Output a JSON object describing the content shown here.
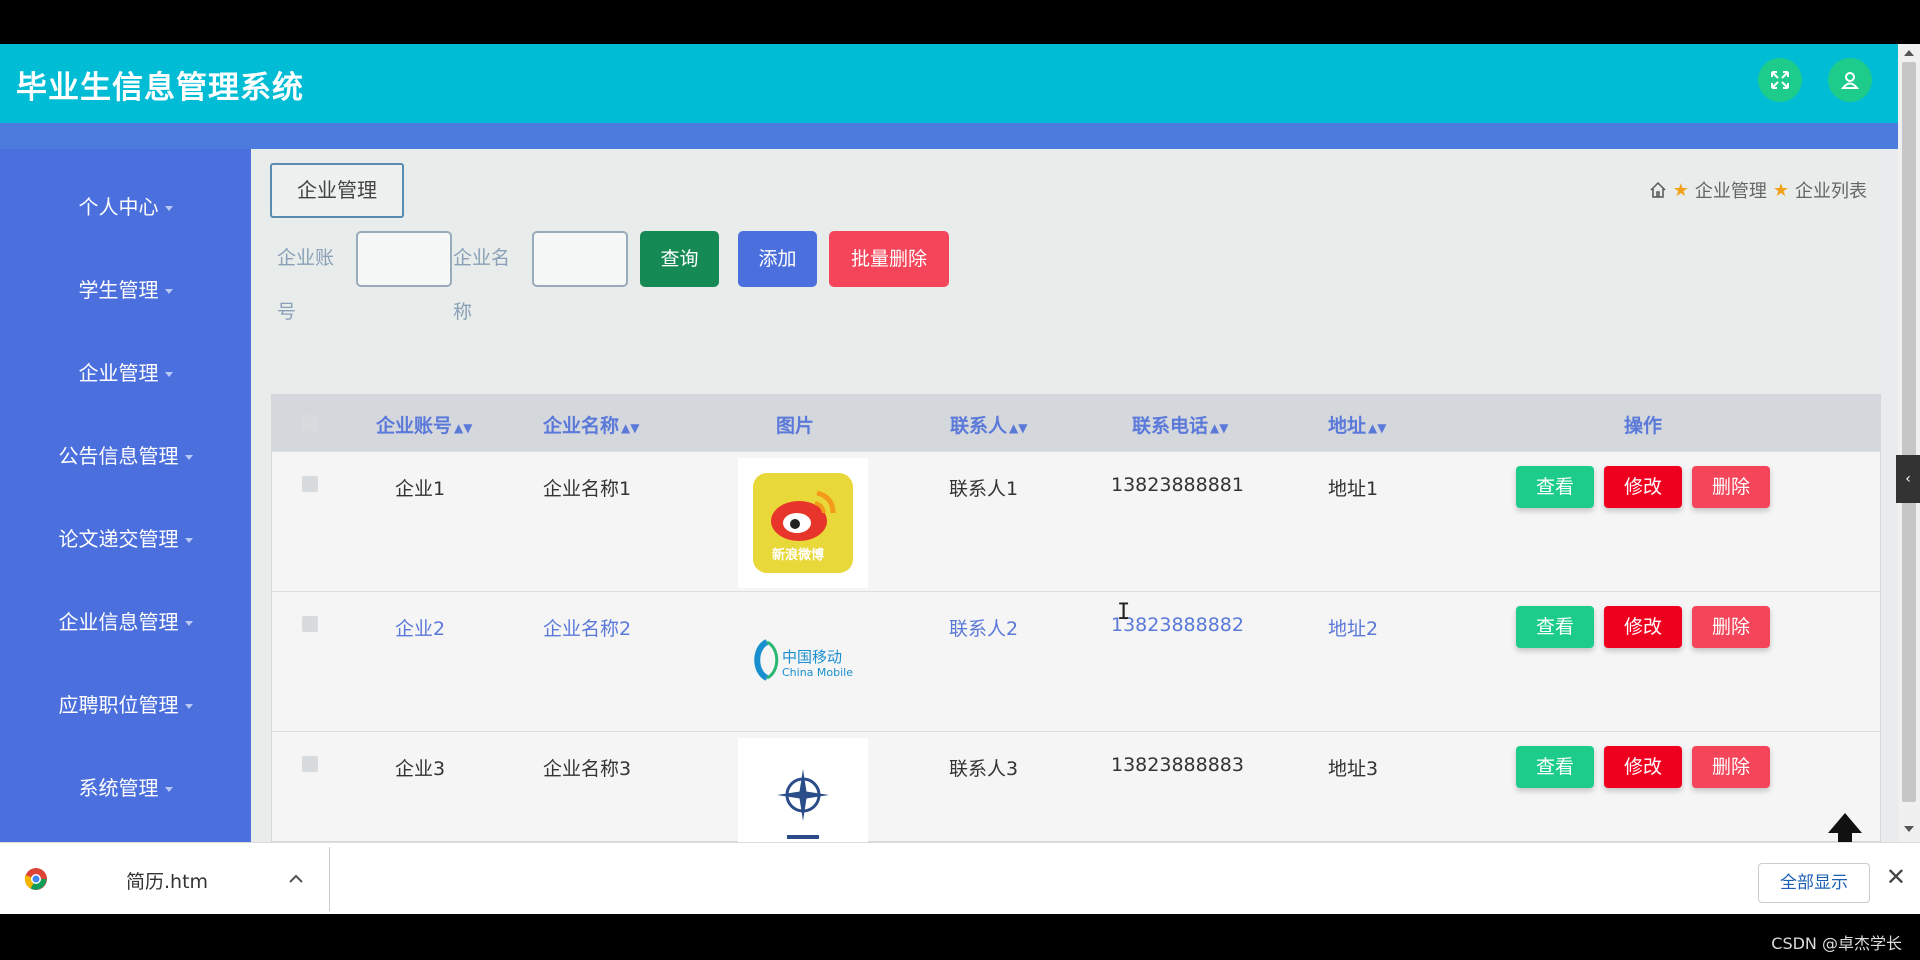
{
  "app": {
    "title": "毕业生信息管理系统"
  },
  "topbar": {
    "fullscreen_icon": "expand-icon",
    "user_icon": "user-icon"
  },
  "sidebar": {
    "items": [
      {
        "label": "个人中心"
      },
      {
        "label": "学生管理"
      },
      {
        "label": "企业管理"
      },
      {
        "label": "公告信息管理"
      },
      {
        "label": "论文递交管理"
      },
      {
        "label": "企业信息管理"
      },
      {
        "label": "应聘职位管理"
      },
      {
        "label": "系统管理"
      }
    ]
  },
  "page": {
    "tag": "企业管理",
    "breadcrumb": {
      "level1": "企业管理",
      "level2": "企业列表"
    }
  },
  "search": {
    "account_label": "企业账号",
    "name_label": "企业名称",
    "account_value": "",
    "name_value": "",
    "query_button": "查询",
    "add_button": "添加",
    "batch_delete_button": "批量删除"
  },
  "table": {
    "headers": {
      "account": "企业账号",
      "name": "企业名称",
      "image": "图片",
      "contact": "联系人",
      "phone": "联系电话",
      "address": "地址",
      "actions": "操作"
    },
    "rows": [
      {
        "account": "企业1",
        "name": "企业名称1",
        "image": "weibo-logo",
        "contact": "联系人1",
        "phone": "13823888881",
        "address": "地址1"
      },
      {
        "account": "企业2",
        "name": "企业名称2",
        "image": "china-mobile-logo",
        "contact": "联系人2",
        "phone": "13823888882",
        "address": "地址2"
      },
      {
        "account": "企业3",
        "name": "企业名称3",
        "image": "compass-logo",
        "contact": "联系人3",
        "phone": "13823888883",
        "address": "地址3"
      }
    ],
    "action_labels": {
      "view": "查看",
      "edit": "修改",
      "delete": "删除"
    }
  },
  "image_text": {
    "weibo": "新浪微博",
    "china_mobile_cn": "中国移动",
    "china_mobile_en": "China Mobile"
  },
  "download_bar": {
    "file": "简历.htm",
    "show_all": "全部显示"
  },
  "watermark": "CSDN @卓杰学长",
  "colors": {
    "topbar": "#00bcd4",
    "sidebar": "#4b6fdd",
    "view_button": "#1dcc8b",
    "edit_button": "#f0001f",
    "delete_button": "#f4455a",
    "query_button": "#168a55",
    "add_button": "#4b6fdd",
    "batch_delete_button": "#f4455a"
  }
}
